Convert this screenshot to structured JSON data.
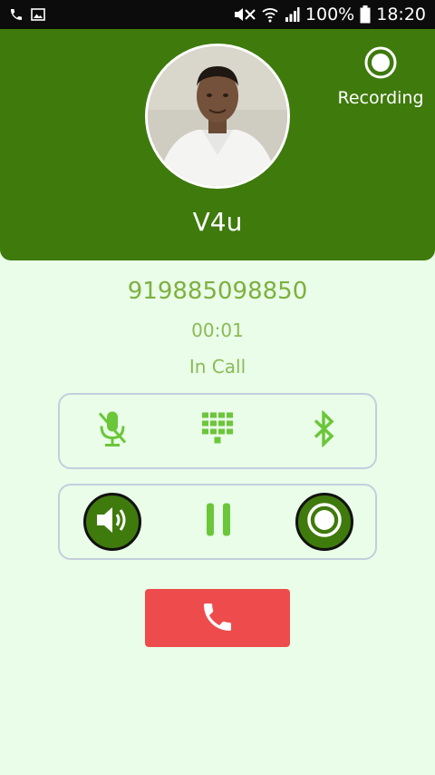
{
  "status_bar": {
    "battery": "100%",
    "time": "18:20"
  },
  "header": {
    "caller_name": "V4u",
    "record_label": "Recording"
  },
  "call": {
    "number": "919885098850",
    "duration": "00:01",
    "status": "In Call"
  },
  "controls_row1": [
    "mute-mic-icon",
    "dialpad-icon",
    "bluetooth-icon"
  ],
  "controls_row2": [
    "speaker-icon",
    "pause-icon",
    "record-icon"
  ],
  "end_call_icon": "phone-icon",
  "colors": {
    "header_green": "#3f7a0c",
    "accent_green": "#7fb03f",
    "icon_green": "#6cc63a",
    "background": "#e9fde9",
    "end_call_red": "#ee4c4c",
    "panel_border": "#c4cedd"
  }
}
